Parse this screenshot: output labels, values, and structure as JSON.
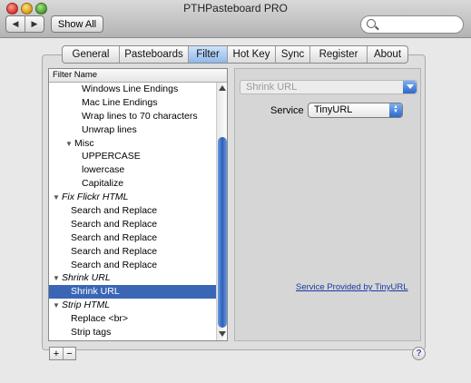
{
  "window": {
    "title": "PTHPasteboard PRO"
  },
  "toolbar": {
    "back_icon": "◀",
    "forward_icon": "▶",
    "show_all_label": "Show All",
    "search_placeholder": ""
  },
  "tabs": [
    {
      "label": "General",
      "active": false
    },
    {
      "label": "Pasteboards",
      "active": false
    },
    {
      "label": "Filter",
      "active": true
    },
    {
      "label": "Hot Key",
      "active": false
    },
    {
      "label": "Sync",
      "active": false
    },
    {
      "label": "Register",
      "active": false
    },
    {
      "label": "About",
      "active": false
    }
  ],
  "filter_list": {
    "header": "Filter Name",
    "rows": [
      {
        "label": "Windows Line Endings",
        "level": 3,
        "type": "item",
        "selected": false
      },
      {
        "label": "Mac Line Endings",
        "level": 3,
        "type": "item",
        "selected": false
      },
      {
        "label": "Wrap lines to 70 characters",
        "level": 3,
        "type": "item",
        "selected": false
      },
      {
        "label": "Unwrap lines",
        "level": 3,
        "type": "item",
        "selected": false
      },
      {
        "label": "Misc",
        "level": 2,
        "type": "folder",
        "selected": false
      },
      {
        "label": "UPPERCASE",
        "level": 3,
        "type": "item",
        "selected": false
      },
      {
        "label": "lowercase",
        "level": 3,
        "type": "item",
        "selected": false
      },
      {
        "label": "Capitalize",
        "level": 3,
        "type": "item",
        "selected": false
      },
      {
        "label": "Fix Flickr HTML",
        "level": 1,
        "type": "group",
        "selected": false
      },
      {
        "label": "Search and Replace",
        "level": 2,
        "type": "item",
        "selected": false
      },
      {
        "label": "Search and Replace",
        "level": 2,
        "type": "item",
        "selected": false
      },
      {
        "label": "Search and Replace",
        "level": 2,
        "type": "item",
        "selected": false
      },
      {
        "label": "Search and Replace",
        "level": 2,
        "type": "item",
        "selected": false
      },
      {
        "label": "Search and Replace",
        "level": 2,
        "type": "item",
        "selected": false
      },
      {
        "label": "Shrink URL",
        "level": 1,
        "type": "group",
        "selected": false
      },
      {
        "label": "Shrink URL",
        "level": 2,
        "type": "item",
        "selected": true
      },
      {
        "label": "Strip HTML",
        "level": 1,
        "type": "group",
        "selected": false
      },
      {
        "label": "Replace <br>",
        "level": 2,
        "type": "item",
        "selected": false
      },
      {
        "label": "Strip tags",
        "level": 2,
        "type": "item",
        "selected": false
      }
    ],
    "add_label": "+",
    "remove_label": "−"
  },
  "config": {
    "filter_type_value": "Shrink URL",
    "service_label": "Service",
    "service_value": "TinyURL",
    "service_link": "Service Provided by TinyURL"
  },
  "help_label": "?",
  "colors": {
    "selection": "#3a66b5",
    "link": "#1a3aa0",
    "tab_active": "#8fb8ea"
  }
}
